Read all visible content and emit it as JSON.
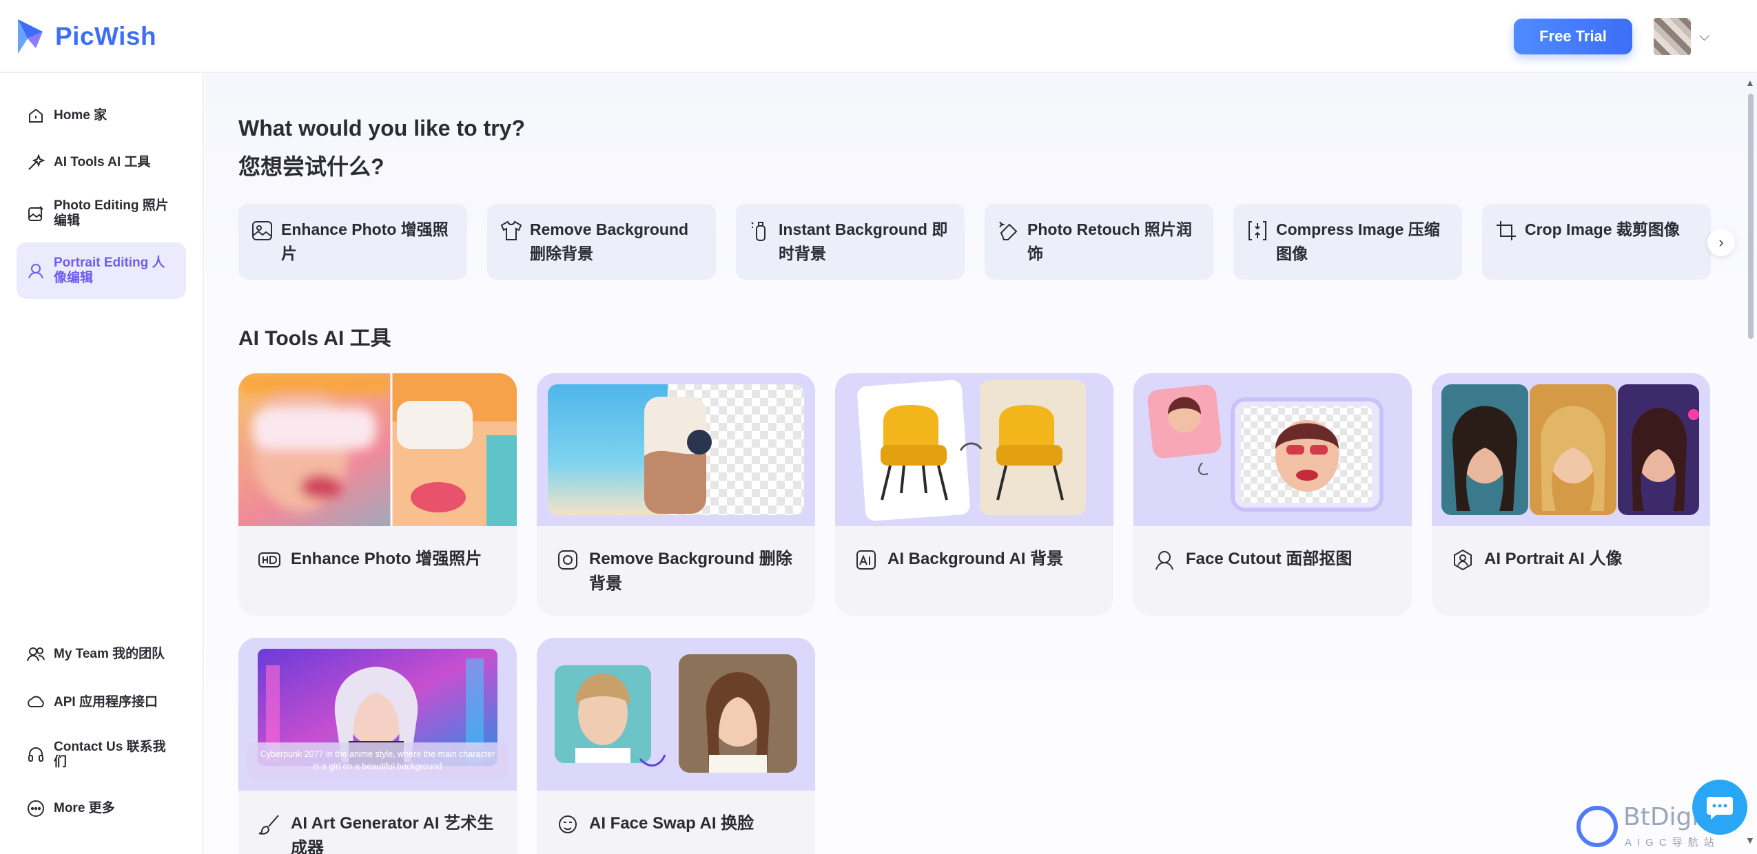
{
  "app": {
    "name": "PicWish"
  },
  "header": {
    "trial_label": "Free Trial"
  },
  "sidebar": {
    "items": [
      {
        "label": "Home 家",
        "icon": "home-icon",
        "active": false
      },
      {
        "label": "AI Tools AI 工具",
        "icon": "magic-wand-icon",
        "active": false
      },
      {
        "label": "Photo Editing 照片编辑",
        "icon": "photo-edit-icon",
        "active": false
      },
      {
        "label": "Portrait Editing 人像编辑",
        "icon": "portrait-icon",
        "active": true
      }
    ],
    "bottom_items": [
      {
        "label": "My Team 我的团队",
        "icon": "team-icon"
      },
      {
        "label": "API 应用程序接口",
        "icon": "api-icon"
      },
      {
        "label": "Contact Us 联系我们",
        "icon": "headset-icon"
      },
      {
        "label": "More 更多",
        "icon": "more-icon"
      }
    ]
  },
  "main": {
    "heading_en": "What would you like to try?",
    "heading_zh": "您想尝试什么?",
    "quick_tools": [
      {
        "label": "Enhance Photo 增强照片",
        "icon": "enhance-photo-icon"
      },
      {
        "label": "Remove Background 删除背景",
        "icon": "shirt-icon"
      },
      {
        "label": "Instant Background 即时背景",
        "icon": "bottle-icon"
      },
      {
        "label": "Photo Retouch 照片润饰",
        "icon": "eraser-icon"
      },
      {
        "label": "Compress Image 压缩图像",
        "icon": "compress-icon"
      },
      {
        "label": "Crop Image 裁剪图像",
        "icon": "crop-icon"
      }
    ],
    "ai_tools_heading": "AI Tools AI 工具",
    "cards": [
      {
        "label": "Enhance Photo 增强照片",
        "icon": "hd-icon"
      },
      {
        "label": "Remove Background 删除背景",
        "icon": "remove-bg-icon"
      },
      {
        "label": "AI Background AI 背景",
        "icon": "ai-background-icon"
      },
      {
        "label": "Face Cutout 面部抠图",
        "icon": "face-cutout-icon"
      },
      {
        "label": "AI Portrait AI 人像",
        "icon": "ai-portrait-icon"
      },
      {
        "label": "AI Art Generator AI 艺术生成器",
        "icon": "brush-icon"
      },
      {
        "label": "AI Face Swap AI 换脸",
        "icon": "face-swap-icon"
      }
    ],
    "art_prompt": "Cyberpunk 2077 in the anime style, where the main character is a girl on a beautiful background"
  },
  "watermark": {
    "text": "BtDigi",
    "sub": "AIGC导航站"
  },
  "colors": {
    "brand": "#3d6ef8",
    "active": "#6d5cf5",
    "card_bg": "#f4f4f8",
    "chat": "#2aa6f7"
  }
}
